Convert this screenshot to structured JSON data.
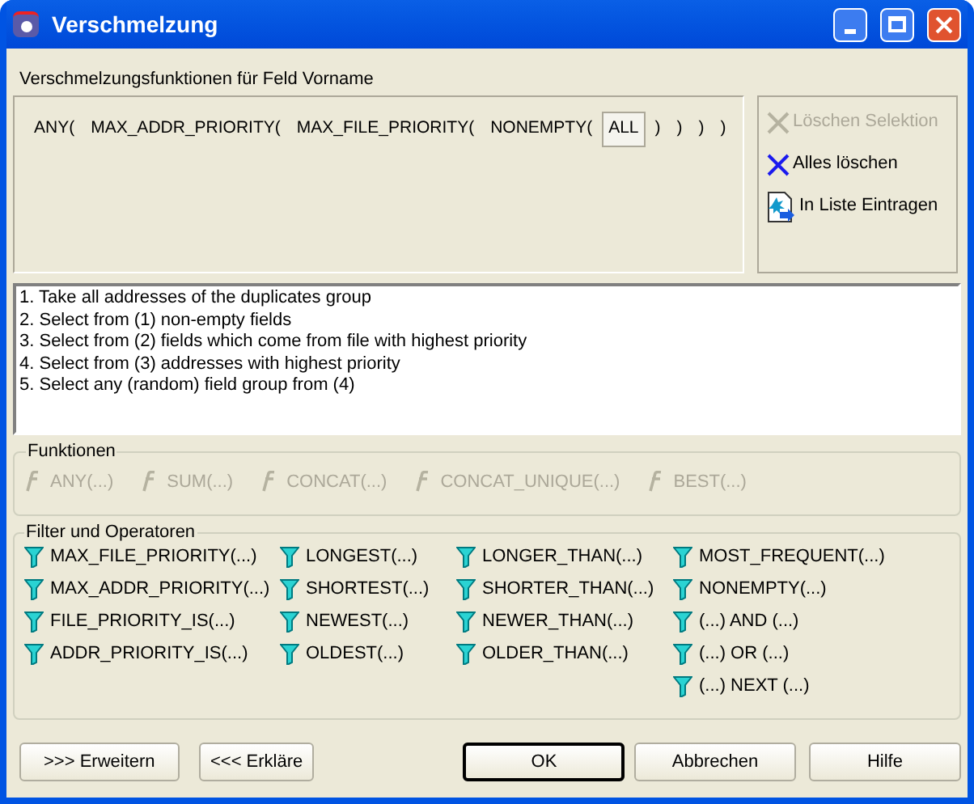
{
  "window": {
    "title": "Verschmelzung"
  },
  "field_label": "Verschmelzungsfunktionen für Feld Vorname",
  "expression": [
    {
      "text": "ANY(",
      "selected": false
    },
    {
      "text": "MAX_ADDR_PRIORITY(",
      "selected": false
    },
    {
      "text": "MAX_FILE_PRIORITY(",
      "selected": false
    },
    {
      "text": "NONEMPTY(",
      "selected": false
    },
    {
      "text": "ALL",
      "selected": true
    },
    {
      "text": ")",
      "selected": false
    },
    {
      "text": ")",
      "selected": false
    },
    {
      "text": ")",
      "selected": false
    },
    {
      "text": ")",
      "selected": false
    }
  ],
  "actions": [
    {
      "kind": "delete",
      "label": "Löschen Selektion",
      "disabled": true
    },
    {
      "kind": "delete",
      "label": "Alles löschen",
      "disabled": false
    },
    {
      "kind": "insert",
      "label": "In Liste Eintragen",
      "disabled": false
    }
  ],
  "explanation": [
    "1. Take all addresses of the duplicates group",
    "2. Select from (1) non-empty fields",
    "3. Select from (2) fields which come from file with highest priority",
    "4. Select from (3) addresses with highest priority",
    "5. Select any (random) field group from (4)"
  ],
  "functions": {
    "title": "Funktionen",
    "items": [
      {
        "label": "ANY(...)",
        "disabled": true
      },
      {
        "label": "SUM(...)",
        "disabled": true
      },
      {
        "label": "CONCAT(...)",
        "disabled": true
      },
      {
        "label": "CONCAT_UNIQUE(...)",
        "disabled": true
      },
      {
        "label": "BEST(...)",
        "disabled": true
      }
    ]
  },
  "filters": {
    "title": "Filter und Operatoren",
    "columns": [
      [
        "MAX_FILE_PRIORITY(...)",
        "MAX_ADDR_PRIORITY(...)",
        "FILE_PRIORITY_IS(...)",
        "ADDR_PRIORITY_IS(...)"
      ],
      [
        "LONGEST(...)",
        "SHORTEST(...)",
        "NEWEST(...)",
        "OLDEST(...)"
      ],
      [
        "LONGER_THAN(...)",
        "SHORTER_THAN(...)",
        "NEWER_THAN(...)",
        "OLDER_THAN(...)"
      ],
      [
        "MOST_FREQUENT(...)",
        "NONEMPTY(...)",
        "(...) AND (...)",
        "(...) OR (...)",
        "(...) NEXT (...)"
      ]
    ]
  },
  "buttons": [
    {
      "label": ">>> Erweitern",
      "default": false
    },
    {
      "label": "<<< Erkläre",
      "default": false
    },
    {
      "label": "OK",
      "default": true
    },
    {
      "label": "Abbrechen",
      "default": false
    },
    {
      "label": "Hilfe",
      "default": false
    }
  ]
}
